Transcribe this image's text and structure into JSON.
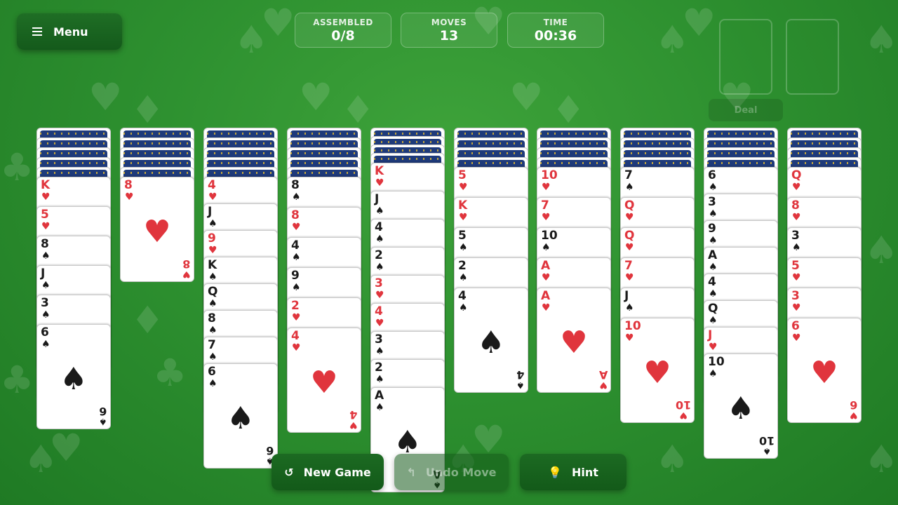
{
  "menu": {
    "label": "Menu",
    "icon": "hamburger-menu-icon"
  },
  "stats": [
    {
      "label": "ASSEMBLED",
      "value": "0/8"
    },
    {
      "label": "MOVES",
      "value": "13"
    },
    {
      "label": "TIME",
      "value": "00:36"
    }
  ],
  "deal": {
    "label": "Deal"
  },
  "tableau": [
    {
      "hidden": 5,
      "cards": [
        {
          "rank": "K",
          "suit": "♥",
          "color": "red"
        },
        {
          "rank": "5",
          "suit": "♥",
          "color": "red"
        },
        {
          "rank": "8",
          "suit": "♠",
          "color": "black"
        },
        {
          "rank": "J",
          "suit": "♠",
          "color": "black"
        },
        {
          "rank": "3",
          "suit": "♠",
          "color": "black"
        },
        {
          "rank": "6",
          "suit": "♠",
          "color": "black"
        }
      ]
    },
    {
      "hidden": 5,
      "cards": [
        {
          "rank": "8",
          "suit": "♥",
          "color": "red"
        }
      ]
    },
    {
      "hidden": 5,
      "cards": [
        {
          "rank": "4",
          "suit": "♥",
          "color": "red"
        },
        {
          "rank": "J",
          "suit": "♠",
          "color": "black"
        },
        {
          "rank": "9",
          "suit": "♥",
          "color": "red"
        },
        {
          "rank": "K",
          "suit": "♠",
          "color": "black"
        },
        {
          "rank": "Q",
          "suit": "♠",
          "color": "black"
        },
        {
          "rank": "8",
          "suit": "♠",
          "color": "black"
        },
        {
          "rank": "7",
          "suit": "♠",
          "color": "black"
        },
        {
          "rank": "6",
          "suit": "♠",
          "color": "black"
        }
      ]
    },
    {
      "hidden": 5,
      "cards": [
        {
          "rank": "8",
          "suit": "♠",
          "color": "black"
        },
        {
          "rank": "8",
          "suit": "♥",
          "color": "red"
        },
        {
          "rank": "4",
          "suit": "♠",
          "color": "black"
        },
        {
          "rank": "9",
          "suit": "♠",
          "color": "black"
        },
        {
          "rank": "2",
          "suit": "♥",
          "color": "red"
        },
        {
          "rank": "4",
          "suit": "♥",
          "color": "red"
        }
      ]
    },
    {
      "hidden": 4,
      "cards": [
        {
          "rank": "K",
          "suit": "♥",
          "color": "red"
        },
        {
          "rank": "J",
          "suit": "♠",
          "color": "black"
        },
        {
          "rank": "4",
          "suit": "♠",
          "color": "black"
        },
        {
          "rank": "2",
          "suit": "♠",
          "color": "black"
        },
        {
          "rank": "3",
          "suit": "♥",
          "color": "red"
        },
        {
          "rank": "4",
          "suit": "♥",
          "color": "red"
        },
        {
          "rank": "3",
          "suit": "♠",
          "color": "black"
        },
        {
          "rank": "2",
          "suit": "♠",
          "color": "black"
        },
        {
          "rank": "A",
          "suit": "♠",
          "color": "black"
        }
      ]
    },
    {
      "hidden": 4,
      "cards": [
        {
          "rank": "5",
          "suit": "♥",
          "color": "red"
        },
        {
          "rank": "K",
          "suit": "♥",
          "color": "red"
        },
        {
          "rank": "5",
          "suit": "♠",
          "color": "black"
        },
        {
          "rank": "2",
          "suit": "♠",
          "color": "black"
        },
        {
          "rank": "4",
          "suit": "♠",
          "color": "black"
        }
      ]
    },
    {
      "hidden": 4,
      "cards": [
        {
          "rank": "10",
          "suit": "♥",
          "color": "red"
        },
        {
          "rank": "7",
          "suit": "♥",
          "color": "red"
        },
        {
          "rank": "10",
          "suit": "♠",
          "color": "black"
        },
        {
          "rank": "A",
          "suit": "♥",
          "color": "red"
        },
        {
          "rank": "A",
          "suit": "♥",
          "color": "red"
        }
      ]
    },
    {
      "hidden": 4,
      "cards": [
        {
          "rank": "7",
          "suit": "♠",
          "color": "black"
        },
        {
          "rank": "Q",
          "suit": "♥",
          "color": "red"
        },
        {
          "rank": "Q",
          "suit": "♥",
          "color": "red"
        },
        {
          "rank": "7",
          "suit": "♥",
          "color": "red"
        },
        {
          "rank": "J",
          "suit": "♠",
          "color": "black"
        },
        {
          "rank": "10",
          "suit": "♥",
          "color": "red"
        }
      ]
    },
    {
      "hidden": 4,
      "cards": [
        {
          "rank": "6",
          "suit": "♠",
          "color": "black"
        },
        {
          "rank": "3",
          "suit": "♠",
          "color": "black"
        },
        {
          "rank": "9",
          "suit": "♠",
          "color": "black"
        },
        {
          "rank": "A",
          "suit": "♠",
          "color": "black"
        },
        {
          "rank": "4",
          "suit": "♠",
          "color": "black"
        },
        {
          "rank": "Q",
          "suit": "♠",
          "color": "black"
        },
        {
          "rank": "J",
          "suit": "♥",
          "color": "red"
        },
        {
          "rank": "10",
          "suit": "♠",
          "color": "black"
        }
      ]
    },
    {
      "hidden": 4,
      "cards": [
        {
          "rank": "Q",
          "suit": "♥",
          "color": "red"
        },
        {
          "rank": "8",
          "suit": "♥",
          "color": "red"
        },
        {
          "rank": "3",
          "suit": "♠",
          "color": "black"
        },
        {
          "rank": "5",
          "suit": "♥",
          "color": "red"
        },
        {
          "rank": "3",
          "suit": "♥",
          "color": "red"
        },
        {
          "rank": "6",
          "suit": "♥",
          "color": "red"
        }
      ]
    }
  ],
  "actions": {
    "new_game": {
      "label": "New Game",
      "icon": "restart-icon"
    },
    "undo": {
      "label": "Undo Move",
      "icon": "undo-icon"
    },
    "hint": {
      "label": "Hint",
      "icon": "lightbulb-icon"
    }
  },
  "colors": {
    "felt": "#2e9130",
    "red_suit": "#e0353d",
    "black_suit": "#1a1a1a",
    "card_back": "#1e3a7a"
  }
}
